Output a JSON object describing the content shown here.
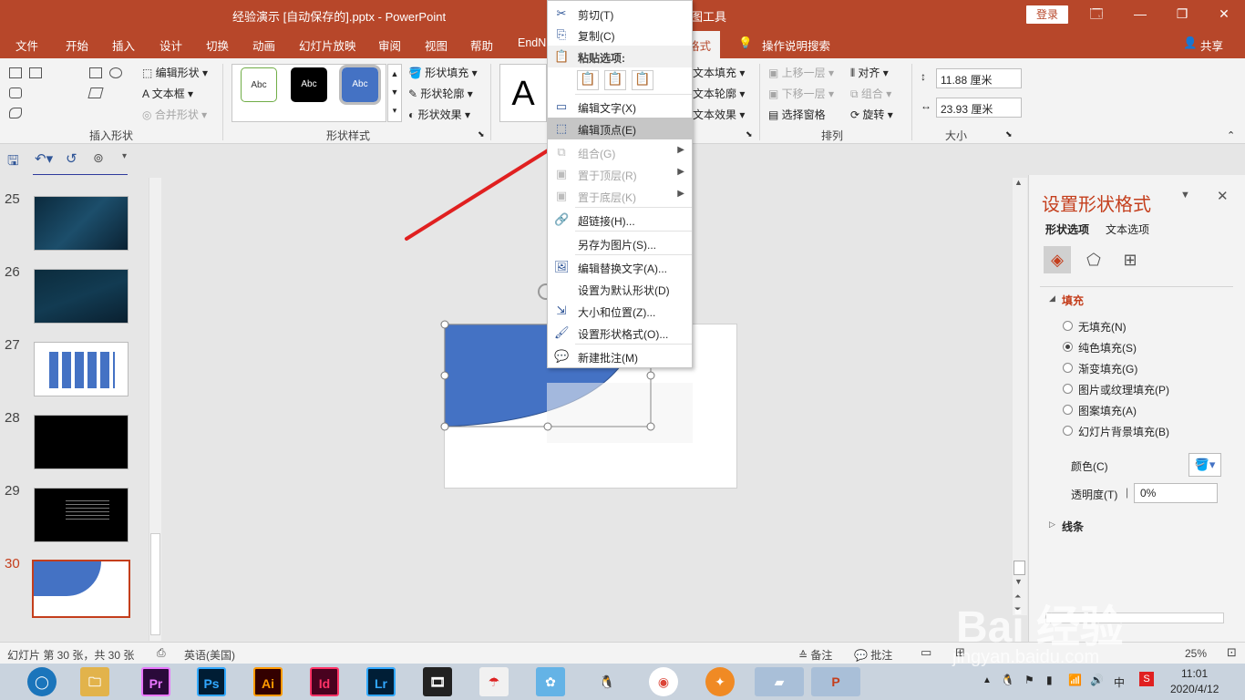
{
  "window": {
    "title": "经验演示 [自动保存的].pptx  -  PowerPoint",
    "context_tab_title": "图工具",
    "login_button": "登录",
    "min": "🗔",
    "restore": "❐",
    "close": "✕"
  },
  "tabs": [
    "文件",
    "开始",
    "插入",
    "设计",
    "切换",
    "动画",
    "幻灯片放映",
    "审阅",
    "视图",
    "帮助",
    "EndN",
    "格式"
  ],
  "tell_me": "操作说明搜索",
  "share": "共享",
  "ribbon": {
    "insert_shapes": {
      "label": "插入形状",
      "edit_shape": "编辑形状",
      "text_box": "文本框",
      "merge_shapes": "合并形状"
    },
    "shape_styles": {
      "label": "形状样式",
      "abc": "Abc",
      "fill": "形状填充",
      "outline": "形状轮廓",
      "effects": "形状效果"
    },
    "wordart": {
      "big_a": "A",
      "text_fill": "文本填充",
      "text_outline": "文本轮廓",
      "text_effects": "文本效果"
    },
    "arrange": {
      "label": "排列",
      "bring_forward": "上移一层",
      "send_backward": "下移一层",
      "selection_pane": "选择窗格",
      "align": "对齐",
      "group": "组合",
      "rotate": "旋转"
    },
    "size": {
      "label": "大小",
      "height": "11.88 厘米",
      "width": "23.93 厘米"
    }
  },
  "slides": [
    {
      "num": "25"
    },
    {
      "num": "26"
    },
    {
      "num": "27"
    },
    {
      "num": "28"
    },
    {
      "num": "29"
    },
    {
      "num": "30"
    }
  ],
  "context_menu": {
    "cut": "剪切(T)",
    "copy": "复制(C)",
    "paste_options": "粘贴选项:",
    "edit_text": "编辑文字(X)",
    "edit_points": "编辑顶点(E)",
    "group": "组合(G)",
    "bring_to_front": "置于顶层(R)",
    "send_to_back": "置于底层(K)",
    "hyperlink": "超链接(H)...",
    "save_as_picture": "另存为图片(S)...",
    "edit_alt_text": "编辑替换文字(A)...",
    "set_default": "设置为默认形状(D)",
    "size_position": "大小和位置(Z)...",
    "format_shape": "设置形状格式(O)...",
    "new_comment": "新建批注(M)"
  },
  "format_pane": {
    "title": "设置形状格式",
    "tab_shape": "形状选项",
    "tab_text": "文本选项",
    "fill_header": "填充",
    "options": [
      "无填充(N)",
      "纯色填充(S)",
      "渐变填充(G)",
      "图片或纹理填充(P)",
      "图案填充(A)",
      "幻灯片背景填充(B)"
    ],
    "selected_option_index": 1,
    "color_label": "颜色(C)",
    "transparency_label": "透明度(T)",
    "transparency_value": "0%",
    "line_header": "线条"
  },
  "statusbar": {
    "slide_info": "幻灯片 第 30 张，共 30 张",
    "language": "英语(美国)",
    "notes": "备注",
    "comments": "批注",
    "zoom": "25%"
  },
  "taskbar": {
    "apps": [
      "Pr",
      "Ps",
      "Ai",
      "Id",
      "Lr"
    ],
    "time": "11:01",
    "date": "2020/4/12",
    "ime": "中"
  },
  "watermark": {
    "text": "Bai 经验",
    "url": "jingyan.baidu.com"
  },
  "colors": {
    "brand": "#b7472a",
    "shape_blue": "#4472c4",
    "arrow_red": "#e02020"
  }
}
